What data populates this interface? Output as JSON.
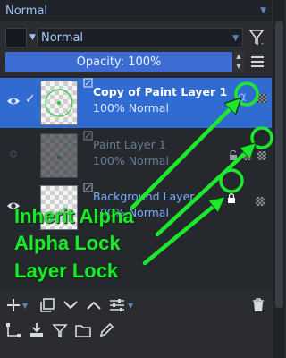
{
  "top_mode": {
    "value": "Normal"
  },
  "filter_row": {
    "blend_mode": "Normal"
  },
  "opacity": {
    "label": "Opacity:  100%"
  },
  "layers": [
    {
      "name": "Copy of Paint Layer 1",
      "mode": "100% Normal",
      "selected": true,
      "visible": true,
      "inherit_alpha": true,
      "alpha_symbol": "α"
    },
    {
      "name": "Paint Layer 1",
      "mode": "100% Normal",
      "selected": false,
      "visible": false,
      "alpha_locked": true
    },
    {
      "name": "Background Layer",
      "mode": "100% Normal",
      "selected": false,
      "visible": true,
      "locked": true
    }
  ],
  "annotations": {
    "line1": "Inherit Alpha",
    "line2": "Alpha Lock",
    "line3": "Layer Lock",
    "color": "#1ee82d"
  },
  "colors": {
    "accent": "#3d6dd3",
    "selection": "#2f6bd0",
    "annotation": "#1ee82d"
  },
  "toolbar_1": [
    "add-layer-icon",
    "duplicate-layer-icon",
    "move-down-icon",
    "move-up-icon",
    "layer-properties-icon",
    "delete-layer-icon"
  ],
  "toolbar_2": [
    "transform-mask-icon",
    "merge-down-icon",
    "filter-mask-icon",
    "group-folder-icon",
    "edit-pencil-icon"
  ]
}
